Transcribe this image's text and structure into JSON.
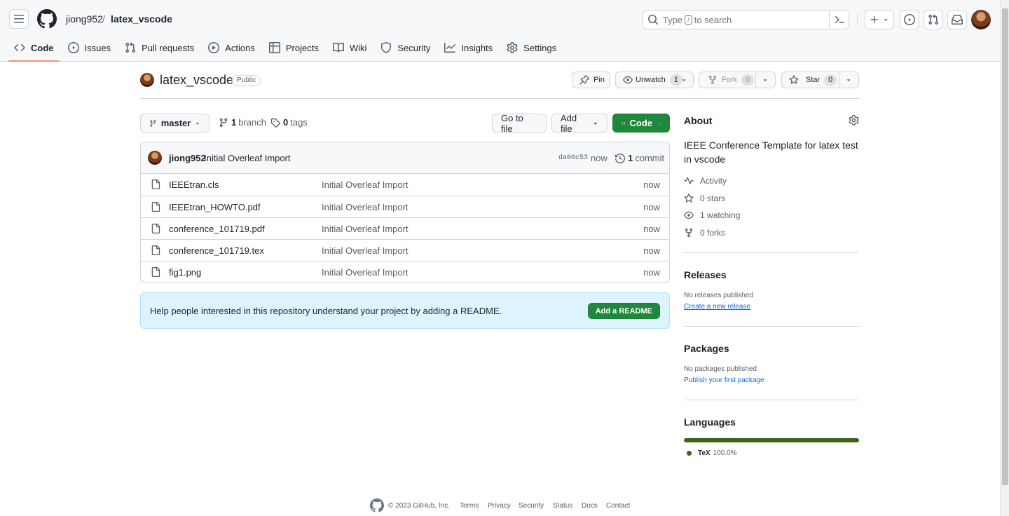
{
  "header": {
    "owner": "jiong952",
    "separator": "/",
    "repo": "latex_vscode",
    "search_prefix": "Type",
    "search_key": "/",
    "search_suffix": "to search"
  },
  "tabs": [
    {
      "label": "Code",
      "icon": "code-icon"
    },
    {
      "label": "Issues",
      "icon": "issue-icon"
    },
    {
      "label": "Pull requests",
      "icon": "pull-request-icon"
    },
    {
      "label": "Actions",
      "icon": "play-icon"
    },
    {
      "label": "Projects",
      "icon": "table-icon"
    },
    {
      "label": "Wiki",
      "icon": "book-icon"
    },
    {
      "label": "Security",
      "icon": "shield-icon"
    },
    {
      "label": "Insights",
      "icon": "graph-icon"
    },
    {
      "label": "Settings",
      "icon": "gear-icon"
    }
  ],
  "repo": {
    "name": "latex_vscode",
    "visibility": "Public",
    "pin_label": "Pin",
    "unwatch_label": "Unwatch",
    "watch_count": "1",
    "fork_label": "Fork",
    "fork_count": "0",
    "star_label": "Star",
    "star_count": "0"
  },
  "toolbar": {
    "branch_name": "master",
    "branch_count": "1",
    "branch_label": "branch",
    "tag_count": "0",
    "tag_label": "tags",
    "go_to_file": "Go to file",
    "add_file": "Add file",
    "code": "Code"
  },
  "commit": {
    "author": "jiong952",
    "message": "Initial Overleaf Import",
    "sha": "da06c53",
    "time": "now",
    "count": "1",
    "count_label": "commit"
  },
  "files": [
    {
      "name": "IEEEtran.cls",
      "message": "Initial Overleaf Import",
      "time": "now"
    },
    {
      "name": "IEEEtran_HOWTO.pdf",
      "message": "Initial Overleaf Import",
      "time": "now"
    },
    {
      "name": "conference_101719.pdf",
      "message": "Initial Overleaf Import",
      "time": "now"
    },
    {
      "name": "conference_101719.tex",
      "message": "Initial Overleaf Import",
      "time": "now"
    },
    {
      "name": "fig1.png",
      "message": "Initial Overleaf Import",
      "time": "now"
    }
  ],
  "readme": {
    "text": "Help people interested in this repository understand your project by adding a README.",
    "button": "Add a README"
  },
  "about": {
    "title": "About",
    "description": "IEEE Conference Template for latex test in vscode",
    "activity": "Activity",
    "stars": "0 stars",
    "watching": "1 watching",
    "forks": "0 forks"
  },
  "releases": {
    "title": "Releases",
    "empty": "No releases published",
    "link": "Create a new release"
  },
  "packages": {
    "title": "Packages",
    "empty": "No packages published",
    "link": "Publish your first package"
  },
  "languages": {
    "title": "Languages",
    "items": [
      {
        "name": "TeX",
        "percent": "100.0%",
        "fraction": 1.0,
        "color": "#3D6117"
      }
    ]
  },
  "footer": {
    "copyright": "© 2023 GitHub, Inc.",
    "links": [
      "Terms",
      "Privacy",
      "Security",
      "Status",
      "Docs",
      "Contact"
    ]
  },
  "colors": {
    "primary_green": "#1f883d",
    "accent_orange": "#fd8c73",
    "link_blue": "#0969da",
    "tex_green": "#3D6117"
  }
}
